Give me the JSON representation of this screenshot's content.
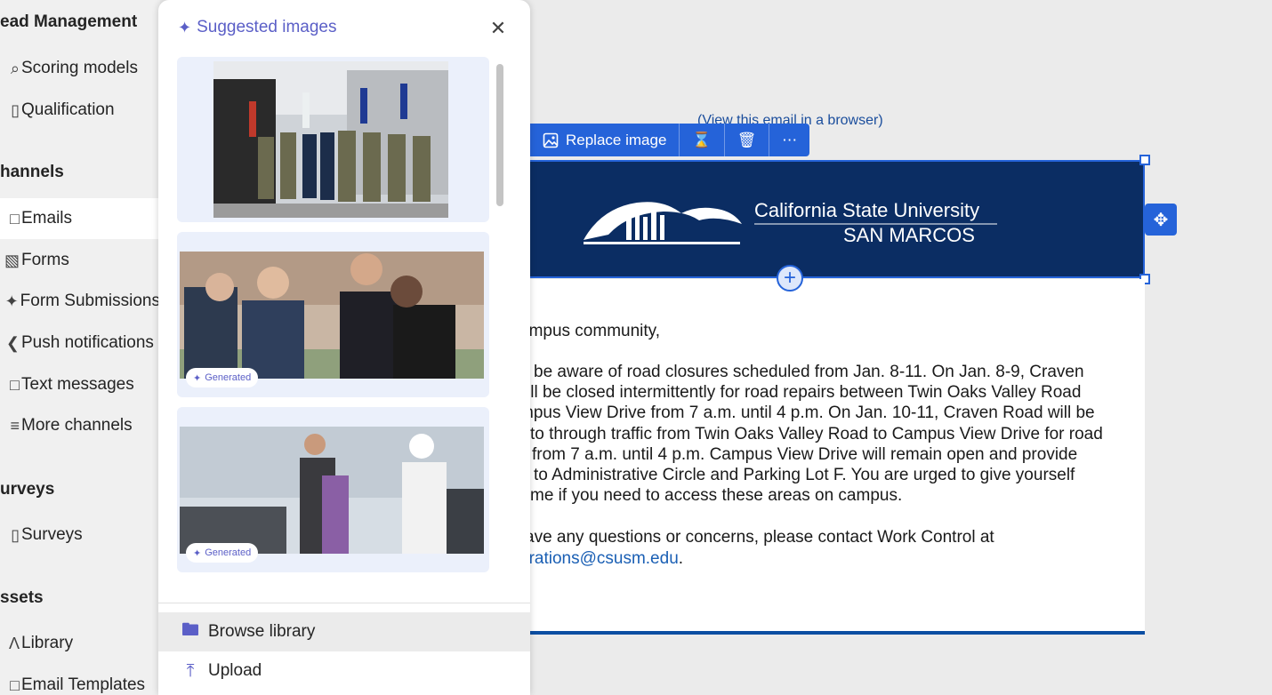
{
  "nav": {
    "groups": [
      {
        "label": "ead Management",
        "items": [
          {
            "label": "Scoring models",
            "icon": "search-icon"
          },
          {
            "label": "Qualification",
            "icon": "document-icon"
          }
        ]
      },
      {
        "label": "hannels",
        "items": [
          {
            "label": "Emails",
            "icon": "mail-icon",
            "active": true
          },
          {
            "label": "Forms",
            "icon": "form-icon"
          },
          {
            "label": "Form Submissions",
            "icon": "submissions-icon"
          },
          {
            "label": "Push notifications",
            "icon": "push-icon"
          },
          {
            "label": "Text messages",
            "icon": "chat-icon"
          },
          {
            "label": "More channels",
            "icon": "channels-icon"
          }
        ]
      },
      {
        "label": "urveys",
        "items": [
          {
            "label": "Surveys",
            "icon": "survey-icon"
          }
        ]
      },
      {
        "label": "ssets",
        "items": [
          {
            "label": "Library",
            "icon": "library-icon"
          },
          {
            "label": "Email Templates",
            "icon": "template-icon"
          }
        ]
      }
    ]
  },
  "panel": {
    "title": "Suggested images",
    "images": [
      {
        "alt": "Group photo with military personnel and flags",
        "generated": false
      },
      {
        "alt": "Business people talking",
        "generated": true,
        "badge": "Generated"
      },
      {
        "alt": "Business meeting in office",
        "generated": true,
        "badge": "Generated"
      }
    ],
    "actions": [
      {
        "label": "Browse library",
        "icon": "folder-search-icon"
      },
      {
        "label": "Upload",
        "icon": "upload-icon"
      }
    ]
  },
  "email": {
    "view_link": "(View this email in a browser)",
    "toolbar": {
      "replace_label": "Replace image"
    },
    "banner": {
      "line1": "California State University",
      "line2": "SAN MARCOS"
    },
    "greeting": "ampus community,",
    "paragraph": [
      "be aware of road closures scheduled from Jan. 8-11. On Jan. 8-9, Craven",
      "ill be closed intermittently for road repairs between Twin Oaks Valley Road",
      "mpus View Drive from 7 a.m. until 4 p.m. On Jan. 10-11, Craven Road will be",
      "to through traffic from Twin Oaks Valley Road to Campus View Drive for road",
      "from 7 a.m. until 4 p.m. Campus View Drive will remain open and provide",
      "to Administrative Circle and Parking Lot F. You are urged to give yourself",
      "me if you need to access these areas on campus."
    ],
    "contact_line": "ave any questions or concerns, please contact Work Control at",
    "contact_email": "erations@csusm.edu",
    "contact_end": "."
  },
  "colors": {
    "accent": "#2563d9",
    "banner": "#0b2d63",
    "copilot": "#5b5fc7"
  }
}
